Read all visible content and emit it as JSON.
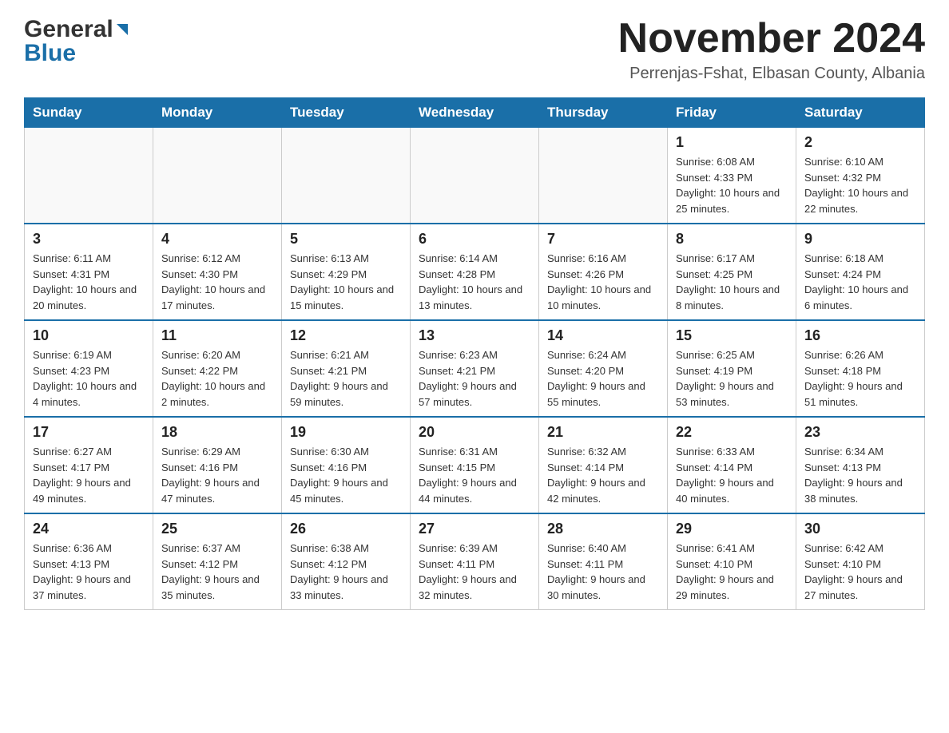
{
  "header": {
    "logo_general": "General",
    "logo_blue": "Blue",
    "month_title": "November 2024",
    "location": "Perrenjas-Fshat, Elbasan County, Albania"
  },
  "days_of_week": [
    "Sunday",
    "Monday",
    "Tuesday",
    "Wednesday",
    "Thursday",
    "Friday",
    "Saturday"
  ],
  "weeks": [
    {
      "days": [
        {
          "number": "",
          "info": ""
        },
        {
          "number": "",
          "info": ""
        },
        {
          "number": "",
          "info": ""
        },
        {
          "number": "",
          "info": ""
        },
        {
          "number": "",
          "info": ""
        },
        {
          "number": "1",
          "info": "Sunrise: 6:08 AM\nSunset: 4:33 PM\nDaylight: 10 hours and 25 minutes."
        },
        {
          "number": "2",
          "info": "Sunrise: 6:10 AM\nSunset: 4:32 PM\nDaylight: 10 hours and 22 minutes."
        }
      ]
    },
    {
      "days": [
        {
          "number": "3",
          "info": "Sunrise: 6:11 AM\nSunset: 4:31 PM\nDaylight: 10 hours and 20 minutes."
        },
        {
          "number": "4",
          "info": "Sunrise: 6:12 AM\nSunset: 4:30 PM\nDaylight: 10 hours and 17 minutes."
        },
        {
          "number": "5",
          "info": "Sunrise: 6:13 AM\nSunset: 4:29 PM\nDaylight: 10 hours and 15 minutes."
        },
        {
          "number": "6",
          "info": "Sunrise: 6:14 AM\nSunset: 4:28 PM\nDaylight: 10 hours and 13 minutes."
        },
        {
          "number": "7",
          "info": "Sunrise: 6:16 AM\nSunset: 4:26 PM\nDaylight: 10 hours and 10 minutes."
        },
        {
          "number": "8",
          "info": "Sunrise: 6:17 AM\nSunset: 4:25 PM\nDaylight: 10 hours and 8 minutes."
        },
        {
          "number": "9",
          "info": "Sunrise: 6:18 AM\nSunset: 4:24 PM\nDaylight: 10 hours and 6 minutes."
        }
      ]
    },
    {
      "days": [
        {
          "number": "10",
          "info": "Sunrise: 6:19 AM\nSunset: 4:23 PM\nDaylight: 10 hours and 4 minutes."
        },
        {
          "number": "11",
          "info": "Sunrise: 6:20 AM\nSunset: 4:22 PM\nDaylight: 10 hours and 2 minutes."
        },
        {
          "number": "12",
          "info": "Sunrise: 6:21 AM\nSunset: 4:21 PM\nDaylight: 9 hours and 59 minutes."
        },
        {
          "number": "13",
          "info": "Sunrise: 6:23 AM\nSunset: 4:21 PM\nDaylight: 9 hours and 57 minutes."
        },
        {
          "number": "14",
          "info": "Sunrise: 6:24 AM\nSunset: 4:20 PM\nDaylight: 9 hours and 55 minutes."
        },
        {
          "number": "15",
          "info": "Sunrise: 6:25 AM\nSunset: 4:19 PM\nDaylight: 9 hours and 53 minutes."
        },
        {
          "number": "16",
          "info": "Sunrise: 6:26 AM\nSunset: 4:18 PM\nDaylight: 9 hours and 51 minutes."
        }
      ]
    },
    {
      "days": [
        {
          "number": "17",
          "info": "Sunrise: 6:27 AM\nSunset: 4:17 PM\nDaylight: 9 hours and 49 minutes."
        },
        {
          "number": "18",
          "info": "Sunrise: 6:29 AM\nSunset: 4:16 PM\nDaylight: 9 hours and 47 minutes."
        },
        {
          "number": "19",
          "info": "Sunrise: 6:30 AM\nSunset: 4:16 PM\nDaylight: 9 hours and 45 minutes."
        },
        {
          "number": "20",
          "info": "Sunrise: 6:31 AM\nSunset: 4:15 PM\nDaylight: 9 hours and 44 minutes."
        },
        {
          "number": "21",
          "info": "Sunrise: 6:32 AM\nSunset: 4:14 PM\nDaylight: 9 hours and 42 minutes."
        },
        {
          "number": "22",
          "info": "Sunrise: 6:33 AM\nSunset: 4:14 PM\nDaylight: 9 hours and 40 minutes."
        },
        {
          "number": "23",
          "info": "Sunrise: 6:34 AM\nSunset: 4:13 PM\nDaylight: 9 hours and 38 minutes."
        }
      ]
    },
    {
      "days": [
        {
          "number": "24",
          "info": "Sunrise: 6:36 AM\nSunset: 4:13 PM\nDaylight: 9 hours and 37 minutes."
        },
        {
          "number": "25",
          "info": "Sunrise: 6:37 AM\nSunset: 4:12 PM\nDaylight: 9 hours and 35 minutes."
        },
        {
          "number": "26",
          "info": "Sunrise: 6:38 AM\nSunset: 4:12 PM\nDaylight: 9 hours and 33 minutes."
        },
        {
          "number": "27",
          "info": "Sunrise: 6:39 AM\nSunset: 4:11 PM\nDaylight: 9 hours and 32 minutes."
        },
        {
          "number": "28",
          "info": "Sunrise: 6:40 AM\nSunset: 4:11 PM\nDaylight: 9 hours and 30 minutes."
        },
        {
          "number": "29",
          "info": "Sunrise: 6:41 AM\nSunset: 4:10 PM\nDaylight: 9 hours and 29 minutes."
        },
        {
          "number": "30",
          "info": "Sunrise: 6:42 AM\nSunset: 4:10 PM\nDaylight: 9 hours and 27 minutes."
        }
      ]
    }
  ]
}
